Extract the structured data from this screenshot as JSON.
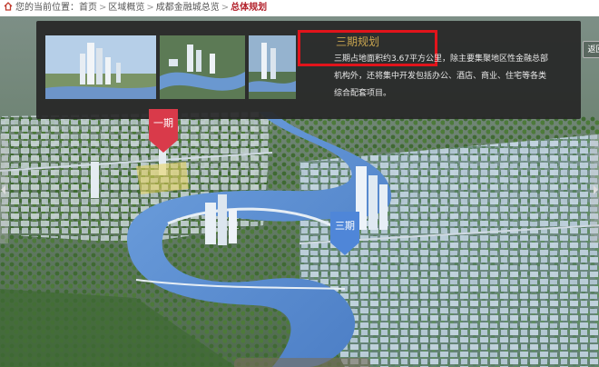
{
  "breadcrumb": {
    "prefix": "您的当前位置：",
    "items": [
      "首页",
      "区域概览",
      "成都金融城总览"
    ],
    "separator": ">",
    "current": "总体规划"
  },
  "info_panel": {
    "title": "三期规划",
    "description": "三期占地面积约3.67平方公里，除主要集聚地区性金融总部机构外，还将集中开发包括办公、酒店、商业、住宅等各类综合配套项目。",
    "back_label": "返回",
    "back_arrows": "»"
  },
  "markers": {
    "phase1": "一期",
    "phase3": "三期"
  },
  "colors": {
    "current_crumb": "#b2202a",
    "title_gold": "#c9a54f",
    "highlight_border": "#e2141b",
    "phase1_marker": "#d93a4a",
    "phase3_marker": "#4f86d8",
    "river": "#5d8fd2"
  },
  "icons": {
    "home": "home-icon",
    "left_nav": "left-arrow-icon",
    "right_nav": "right-arrow-icon"
  }
}
